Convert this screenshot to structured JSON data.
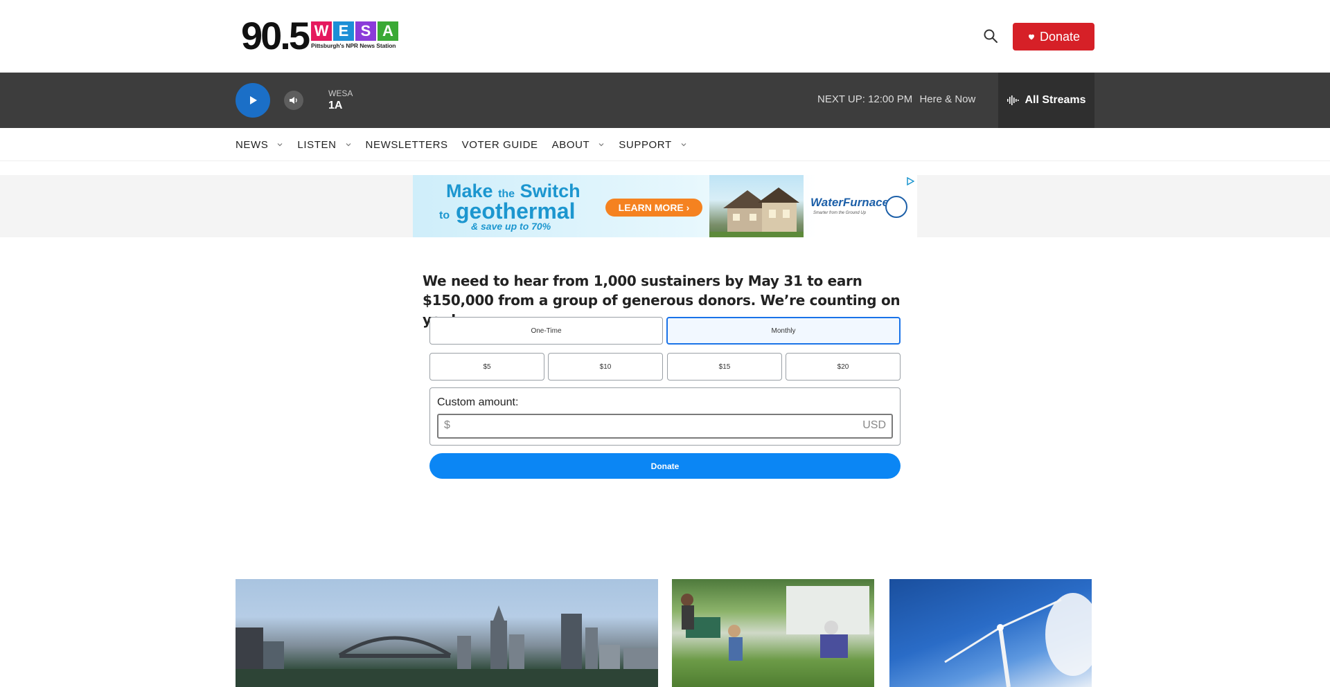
{
  "header": {
    "logo": {
      "number": "90.5",
      "letters": [
        "W",
        "E",
        "S",
        "A"
      ],
      "letter_colors": [
        "#e5195e",
        "#1c8fd6",
        "#8b3bd9",
        "#3aa935"
      ],
      "tagline": "Pittsburgh's NPR News Station"
    },
    "search_icon": "search-icon",
    "donate_label": "Donate"
  },
  "player": {
    "station": "WESA",
    "show": "1A",
    "next_up_label": "NEXT UP:",
    "next_up_time": "12:00 PM",
    "next_up_show": "Here & Now",
    "all_streams_label": "All Streams"
  },
  "nav": {
    "items": [
      {
        "label": "NEWS",
        "has_dropdown": true
      },
      {
        "label": "LISTEN",
        "has_dropdown": true
      },
      {
        "label": "NEWSLETTERS",
        "has_dropdown": false
      },
      {
        "label": "VOTER GUIDE",
        "has_dropdown": false
      },
      {
        "label": "ABOUT",
        "has_dropdown": true
      },
      {
        "label": "SUPPORT",
        "has_dropdown": true
      }
    ]
  },
  "ad": {
    "line1a": "Make",
    "line1b": "the",
    "line1c": "Switch",
    "line2a": "to",
    "line2b": "geothermal",
    "line3": "& save up to 70%",
    "cta": "LEARN MORE ›",
    "brand": "WaterFurnace",
    "brand_sub": "Smarter from the Ground Up"
  },
  "donation": {
    "pitch": "We need to hear from 1,000 sustainers by May 31 to earn $150,000 from a group of generous donors. We’re counting on you!",
    "frequency": {
      "options": [
        "One-Time",
        "Monthly"
      ],
      "selected": "Monthly"
    },
    "amounts": [
      "$5",
      "$10",
      "$15",
      "$20"
    ],
    "custom_label": "Custom amount:",
    "currency_symbol": "$",
    "currency_code": "USD",
    "custom_value": "",
    "submit_label": "Donate"
  },
  "colors": {
    "donate_red": "#d62027",
    "player_bg": "#3d3d3d",
    "play_blue": "#1b6fc7",
    "form_blue": "#0b86f4"
  }
}
